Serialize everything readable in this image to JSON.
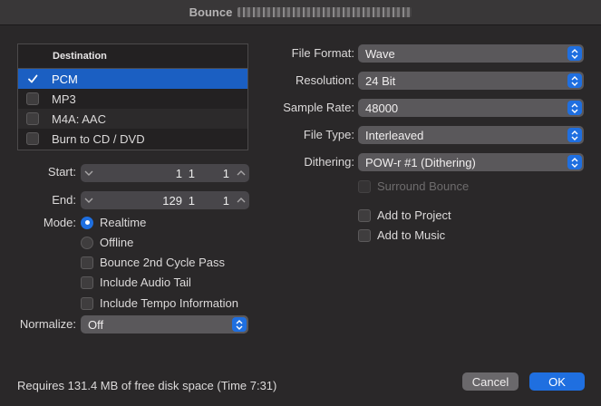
{
  "window": {
    "title": "Bounce"
  },
  "destination": {
    "header": "Destination",
    "items": [
      {
        "label": "PCM",
        "checked": true
      },
      {
        "label": "MP3",
        "checked": false
      },
      {
        "label": "M4A: AAC",
        "checked": false
      },
      {
        "label": "Burn to CD / DVD",
        "checked": false
      }
    ]
  },
  "start": {
    "label": "Start:",
    "values": [
      "1",
      "1",
      "1"
    ]
  },
  "end": {
    "label": "End:",
    "values": [
      "129",
      "1",
      "1"
    ]
  },
  "mode": {
    "label": "Mode:",
    "options": [
      {
        "label": "Realtime",
        "selected": true
      },
      {
        "label": "Offline",
        "selected": false
      }
    ]
  },
  "options": [
    {
      "label": "Bounce 2nd Cycle Pass",
      "checked": false
    },
    {
      "label": "Include Audio Tail",
      "checked": false
    },
    {
      "label": "Include Tempo Information",
      "checked": false
    }
  ],
  "normalize": {
    "label": "Normalize:",
    "value": "Off"
  },
  "file_format": {
    "label": "File Format:",
    "value": "Wave"
  },
  "resolution": {
    "label": "Resolution:",
    "value": "24 Bit"
  },
  "sample_rate": {
    "label": "Sample Rate:",
    "value": "48000"
  },
  "file_type": {
    "label": "File Type:",
    "value": "Interleaved"
  },
  "dithering": {
    "label": "Dithering:",
    "value": "POW-r #1 (Dithering)"
  },
  "right_options": [
    {
      "label": "Surround Bounce",
      "checked": false,
      "disabled": true
    },
    {
      "label": "Add to Project",
      "checked": false,
      "disabled": false
    },
    {
      "label": "Add to Music",
      "checked": false,
      "disabled": false
    }
  ],
  "footer": {
    "disk_space": "Requires 131.4 MB of free disk space  (Time 7:31)",
    "cancel": "Cancel",
    "ok": "OK"
  },
  "colors": {
    "accent": "#1f6fe0",
    "selection": "#1b5fc2",
    "background": "#2a2829"
  }
}
